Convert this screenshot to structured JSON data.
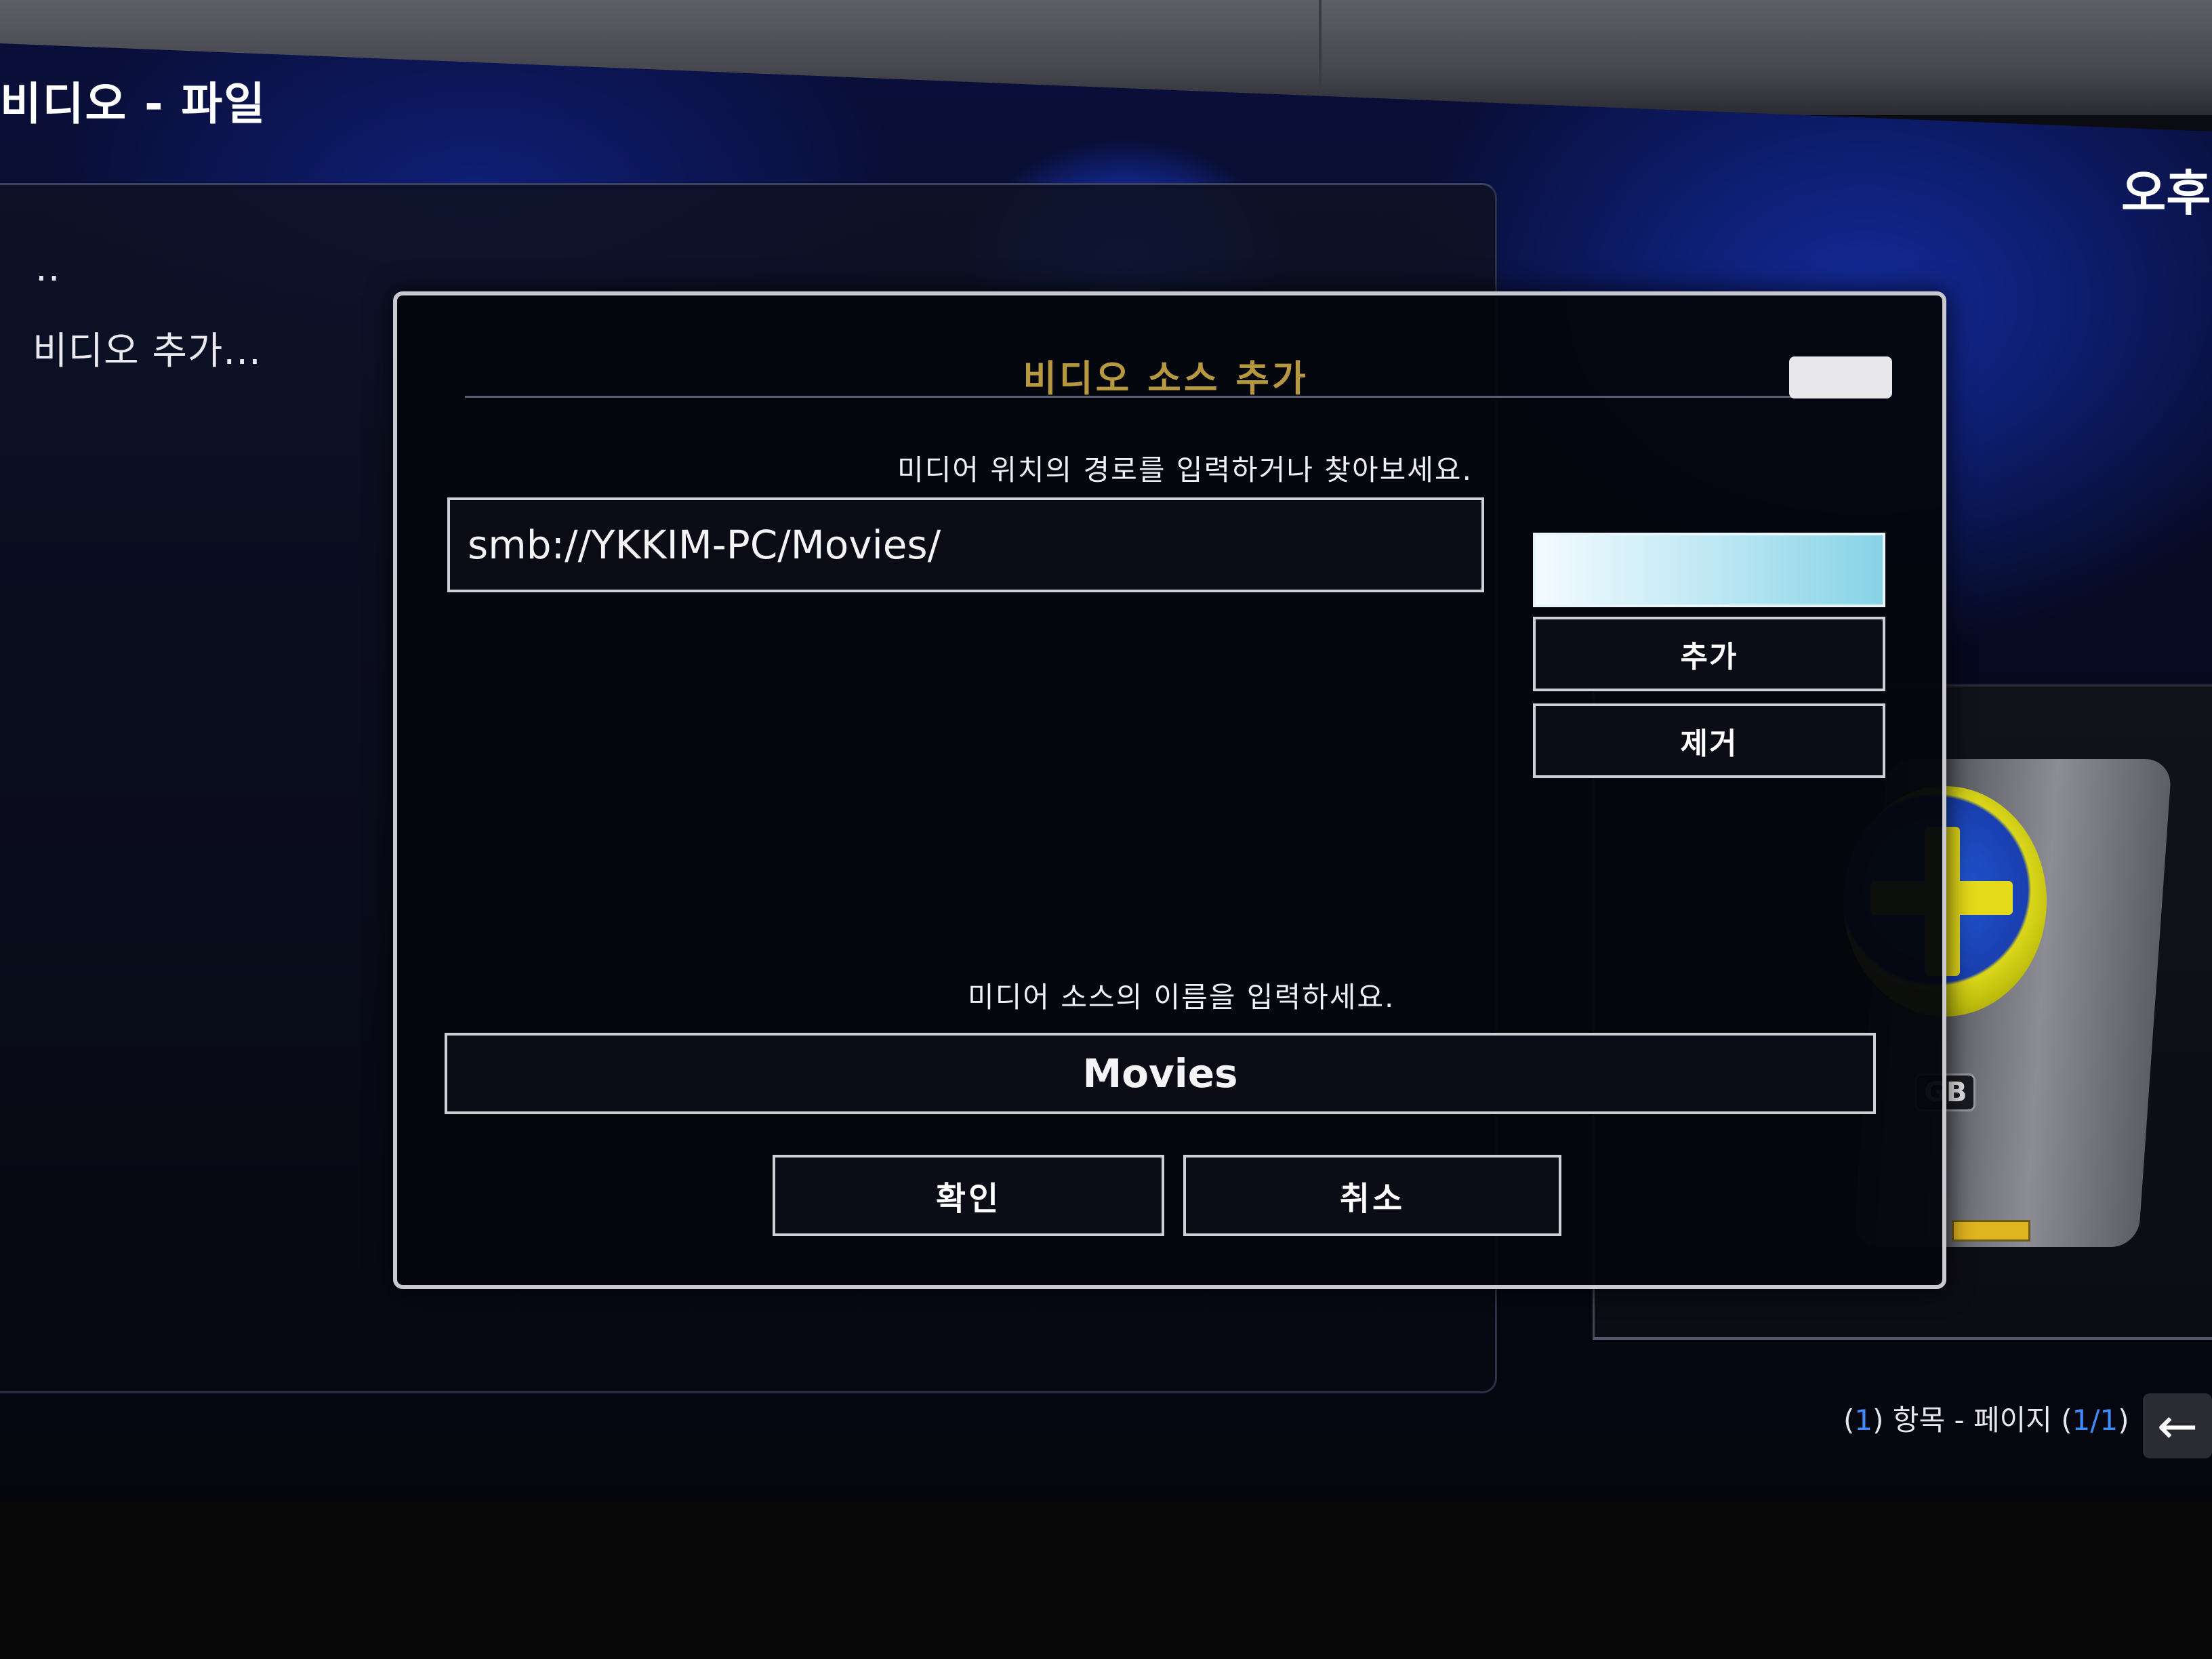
{
  "header": {
    "title": "비디오  - 파일",
    "clock": "오후"
  },
  "file_list": {
    "items": [
      "..",
      "비디오 추가..."
    ]
  },
  "media_panel": {
    "badge": "GB"
  },
  "footer": {
    "prefix": "(",
    "count": "1",
    "label": ") 항목 - 페이지 (",
    "page": "1/1",
    "suffix": ")"
  },
  "dialog": {
    "title": "비디오 소스 추가",
    "close_label": "",
    "path_prompt": "미디어 위치의 경로를 입력하거나 찾아보세요.",
    "path_value": "smb://YKKIM-PC/Movies/",
    "browse_label": "",
    "add_label": "추가",
    "remove_label": "제거",
    "name_prompt": "미디어 소스의 이름을 입력하세요.",
    "name_value": "Movies",
    "ok_label": "확인",
    "cancel_label": "취소"
  },
  "icons": {
    "back": "back-arrow-icon",
    "plus": "add-source-plus-icon"
  },
  "colors": {
    "accent_blue": "#3f8cff",
    "title_gold": "#d4b24a",
    "focus_cyan": "#86d3e6"
  }
}
